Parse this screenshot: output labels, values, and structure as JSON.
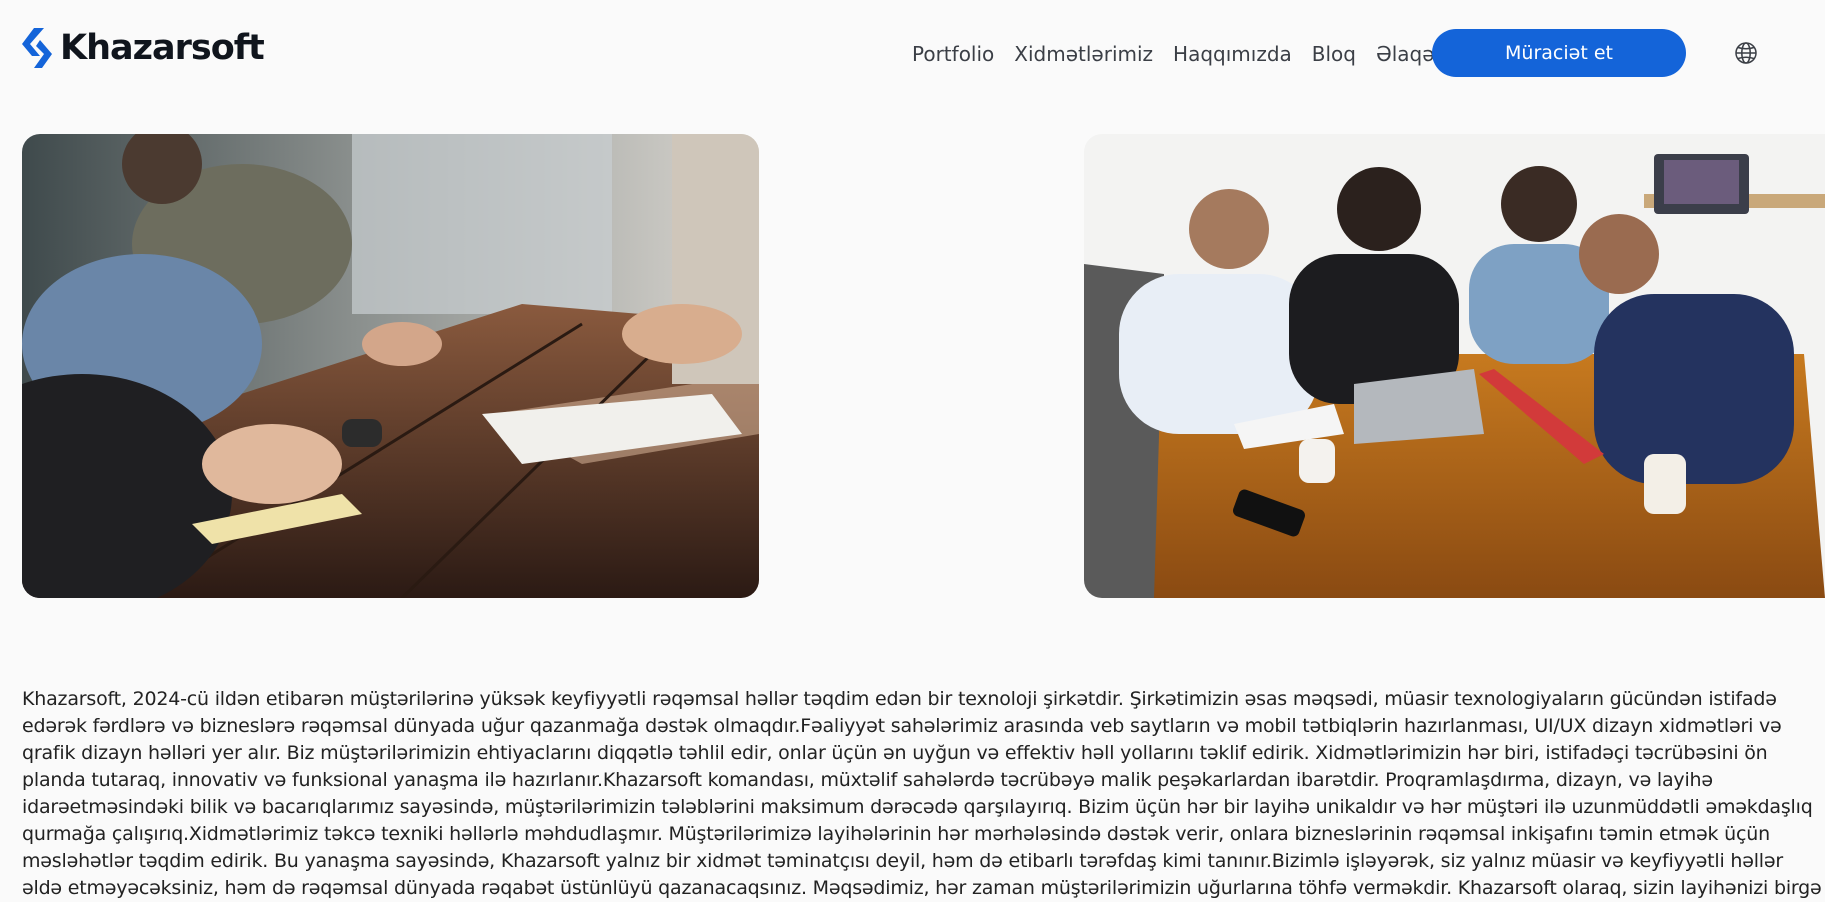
{
  "brand": {
    "name": "Khazarsoft",
    "logo_icon": "khazarsoft-chevron-logo",
    "accent_color": "#1464d9"
  },
  "nav": {
    "items": [
      {
        "label": "Portfolio"
      },
      {
        "label": "Xidmətlərimiz"
      },
      {
        "label": "Haqqımızda"
      },
      {
        "label": "Bloq"
      },
      {
        "label": "Əlaqə"
      }
    ],
    "cta_label": "Müraciət et",
    "language_icon": "globe-icon"
  },
  "images": {
    "left": "team-meeting-wooden-table-photo",
    "right": "team-collaborating-laptop-photo"
  },
  "about": {
    "text": "Khazarsoft, 2024-cü ildən etibarən müştərilərinə yüksək keyfiyyətli rəqəmsal həllər təqdim edən bir texnoloji şirkətdir. Şirkətimizin əsas məqsədi, müasir texnologiyaların gücündən istifadə edərək fərdlərə və bizneslərə rəqəmsal dünyada uğur qazanmağa dəstək olmaqdır.Fəaliyyət sahələrimiz arasında veb saytların və mobil tətbiqlərin hazırlanması, UI/UX dizayn xidmətləri və qrafik dizayn həlləri yer alır. Biz müştərilərimizin ehtiyaclarını diqqətlə təhlil edir, onlar üçün ən uyğun və effektiv həll yollarını təklif edirik. Xidmətlərimizin hər biri, istifadəçi təcrübəsini ön planda tutaraq, innovativ və funksional yanaşma ilə hazırlanır.Khazarsoft komandası, müxtəlif sahələrdə təcrübəyə malik peşəkarlardan ibarətdir. Proqramlaşdırma, dizayn, və layihə idarəetməsindəki bilik və bacarıqlarımız sayəsində, müştərilərimizin tələblərini maksimum dərəcədə qarşılayırıq. Bizim üçün hər bir layihə unikaldır və hər müştəri ilə uzunmüddətli əməkdaşlıq qurmağa çalışırıq.Xidmətlərimiz təkcə texniki həllərlə məhdudlaşmır. Müştərilərimizə layihələrinin hər mərhələsində dəstək verir, onlara bizneslərinin rəqəmsal inkişafını təmin etmək üçün məsləhətlər təqdim edirik. Bu yanaşma sayəsində, Khazarsoft yalnız bir xidmət təminatçısı deyil, həm də etibarlı tərəfdaş kimi tanınır.Bizimlə işləyərək, siz yalnız müasir və keyfiyyətli həllər əldə etməyəcəksiniz, həm də rəqəmsal dünyada rəqabət üstünlüyü qazanacaqsınız. Məqsədimiz, hər zaman müştərilərimizin uğurlarına töhfə verməkdir. Khazarsoft olaraq, sizin layihənizi birgə"
  }
}
